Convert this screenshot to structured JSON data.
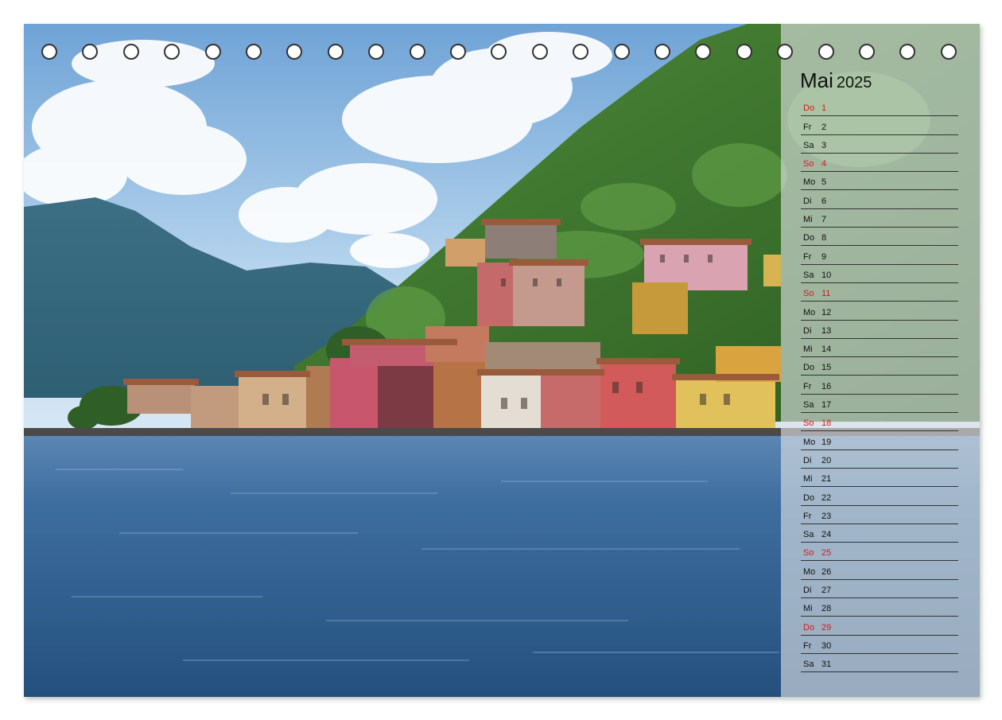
{
  "calendar": {
    "month": "Mai",
    "year": "2025",
    "days": [
      {
        "wd": "Do",
        "d": "1",
        "holiday": true
      },
      {
        "wd": "Fr",
        "d": "2"
      },
      {
        "wd": "Sa",
        "d": "3"
      },
      {
        "wd": "So",
        "d": "4",
        "holiday": true
      },
      {
        "wd": "Mo",
        "d": "5"
      },
      {
        "wd": "Di",
        "d": "6"
      },
      {
        "wd": "Mi",
        "d": "7"
      },
      {
        "wd": "Do",
        "d": "8"
      },
      {
        "wd": "Fr",
        "d": "9"
      },
      {
        "wd": "Sa",
        "d": "10"
      },
      {
        "wd": "So",
        "d": "11",
        "holiday": true
      },
      {
        "wd": "Mo",
        "d": "12"
      },
      {
        "wd": "Di",
        "d": "13"
      },
      {
        "wd": "Mi",
        "d": "14"
      },
      {
        "wd": "Do",
        "d": "15"
      },
      {
        "wd": "Fr",
        "d": "16"
      },
      {
        "wd": "Sa",
        "d": "17"
      },
      {
        "wd": "So",
        "d": "18",
        "holiday": true
      },
      {
        "wd": "Mo",
        "d": "19"
      },
      {
        "wd": "Di",
        "d": "20"
      },
      {
        "wd": "Mi",
        "d": "21"
      },
      {
        "wd": "Do",
        "d": "22"
      },
      {
        "wd": "Fr",
        "d": "23"
      },
      {
        "wd": "Sa",
        "d": "24"
      },
      {
        "wd": "So",
        "d": "25",
        "holiday": true
      },
      {
        "wd": "Mo",
        "d": "26"
      },
      {
        "wd": "Di",
        "d": "27"
      },
      {
        "wd": "Mi",
        "d": "28"
      },
      {
        "wd": "Do",
        "d": "29",
        "holiday": true
      },
      {
        "wd": "Fr",
        "d": "30"
      },
      {
        "wd": "Sa",
        "d": "31"
      }
    ]
  },
  "colors": {
    "holiday": "#d21c1c",
    "text": "#111111",
    "lake": "#2f5f95",
    "sky": "#9cc4e4",
    "forest": "#3f7a2e"
  },
  "rings": {
    "count": 23
  }
}
